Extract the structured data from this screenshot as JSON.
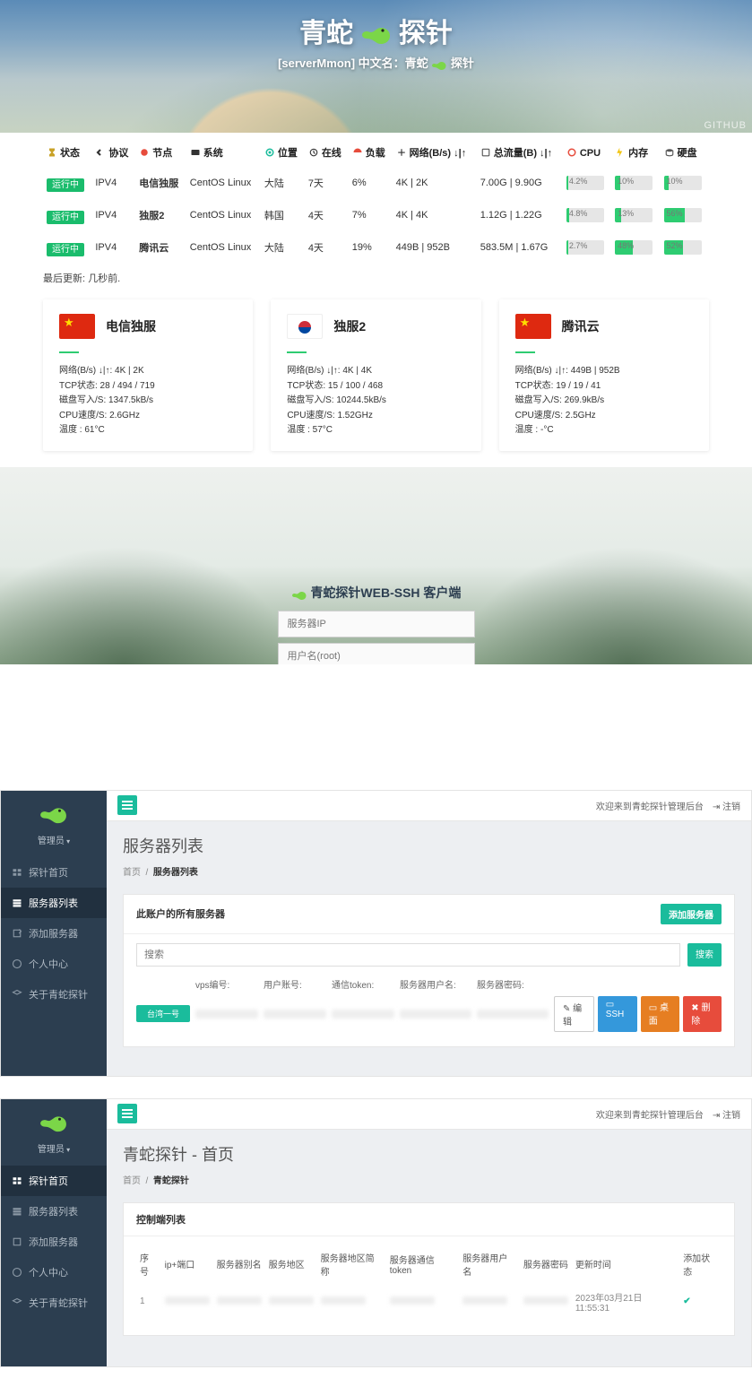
{
  "hero": {
    "title_pre": "青蛇",
    "title_post": "探针",
    "subtitle_pre": "[serverMmon] 中文名：青蛇",
    "subtitle_post": "探针",
    "github": "GITHUB"
  },
  "columns": {
    "status": "状态",
    "proto": "协议",
    "node": "节点",
    "os": "系统",
    "loc": "位置",
    "online": "在线",
    "load": "负载",
    "net": "网络(B/s) ↓|↑",
    "total": "总流量(B) ↓|↑",
    "cpu": "CPU",
    "mem": "内存",
    "disk": "硬盘"
  },
  "rows": [
    {
      "status": "运行中",
      "proto": "IPV4",
      "node": "电信独服",
      "os": "CentOS Linux",
      "loc": "大陆",
      "online": "7天",
      "load": "6%",
      "net": "4K | 2K",
      "total": "7.00G | 9.90G",
      "cpu": "4.2%",
      "cpu_w": 6,
      "mem": "10%",
      "mem_w": 14,
      "disk": "10%",
      "disk_w": 14
    },
    {
      "status": "运行中",
      "proto": "IPV4",
      "node": "独服2",
      "os": "CentOS Linux",
      "loc": "韩国",
      "online": "4天",
      "load": "7%",
      "net": "4K | 4K",
      "total": "1.12G | 1.22G",
      "cpu": "4.8%",
      "cpu_w": 7,
      "mem": "13%",
      "mem_w": 17,
      "disk": "56%",
      "disk_w": 56
    },
    {
      "status": "运行中",
      "proto": "IPV4",
      "node": "腾讯云",
      "os": "CentOS Linux",
      "loc": "大陆",
      "online": "4天",
      "load": "19%",
      "net": "449B | 952B",
      "total": "583.5M | 1.67G",
      "cpu": "2.7%",
      "cpu_w": 5,
      "mem": "48%",
      "mem_w": 48,
      "disk": "52%",
      "disk_w": 52
    }
  ],
  "last_update": "最后更新: 几秒前.",
  "cards": [
    {
      "flag": "cn",
      "name": "电信独服",
      "net": "网络(B/s) ↓|↑:  4K | 2K",
      "tcp": "TCP状态:  28 / 494 / 719",
      "disk": "磁盘写入/S:  1347.5kB/s",
      "cpu": "CPU速度/S:  2.6GHz",
      "temp": "温度 : 61°C"
    },
    {
      "flag": "kr",
      "name": "独服2",
      "net": "网络(B/s) ↓|↑:  4K | 4K",
      "tcp": "TCP状态:  15 / 100 / 468",
      "disk": "磁盘写入/S:  10244.5kB/s",
      "cpu": "CPU速度/S:  1.52GHz",
      "temp": "温度 : 57°C"
    },
    {
      "flag": "cn",
      "name": "腾讯云",
      "net": "网络(B/s) ↓|↑:  449B | 952B",
      "tcp": "TCP状态:  19 / 19 / 41",
      "disk": "磁盘写入/S:  269.9kB/s",
      "cpu": "CPU速度/S:  2.5GHz",
      "temp": "温度 : -°C"
    }
  ],
  "ssh": {
    "title": "青蛇探针WEB-SSH 客户端",
    "ip_ph": "服务器IP",
    "user_ph": "用户名(root)"
  },
  "admin_common": {
    "user": "管理员",
    "welcome": "欢迎来到青蛇探针管理后台",
    "logout": "注销",
    "nav": {
      "home": "探针首页",
      "servers": "服务器列表",
      "add": "添加服务器",
      "profile": "个人中心",
      "about": "关于青蛇探针"
    }
  },
  "adminA": {
    "title": "服务器列表",
    "bc_home": "首页",
    "bc_cur": "服务器列表",
    "panel_title": "此账户的所有服务器",
    "add_btn": "添加服务器",
    "search_ph": "搜索",
    "search_btn": "搜索",
    "row": {
      "tag": "台湾一号",
      "heads": {
        "c2": "vps编号:",
        "c3": "用户账号:",
        "c4": "通信token:",
        "c5": "服务器用户名:",
        "c6": "服务器密码:"
      },
      "actions": {
        "edit": "编辑",
        "ssh": "SSH",
        "desk": "桌面",
        "del": "删除"
      }
    }
  },
  "adminB": {
    "title": "青蛇探针 - 首页",
    "bc_home": "首页",
    "bc_cur": "青蛇探针",
    "panel_title": "控制端列表",
    "heads": {
      "seq": "序号",
      "ip": "ip+端口",
      "alias": "服务器别名",
      "region": "服务地区",
      "regionName": "服务器地区简称",
      "token": "服务器通信token",
      "user": "服务器用户名",
      "pass": "服务器密码",
      "updated": "更新时间",
      "status": "添加状态"
    },
    "row": {
      "seq": "1",
      "updated": "2023年03月21日 11:55:31"
    }
  }
}
